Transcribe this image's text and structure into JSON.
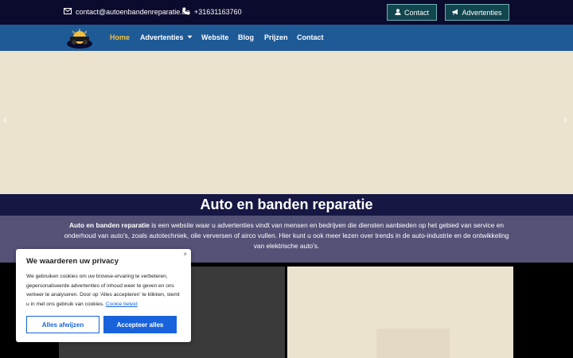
{
  "topbar": {
    "email": "contact@autoenbandenreparatie.be",
    "phone": "+31631163760",
    "contact_button": "Contact",
    "ads_button": "Advertenties"
  },
  "nav": {
    "items": [
      "Home",
      "Advertenties",
      "Website",
      "Blog",
      "Prijzen",
      "Contact"
    ],
    "active": "Home"
  },
  "hero": {
    "prev_arrow": "‹",
    "next_arrow": "›"
  },
  "page": {
    "title": "Auto en banden reparatie",
    "intro_bold": "Auto en banden reparatie",
    "intro_rest": " is een website waar u advertenties vindt van mensen en bedrijven die diensten aanbieden op het gebied van service en onderhoud van auto's, zoals autotechniek, olie verversen of airco vullen. Hier kunt u ook meer lezen over trends in de auto-industrie en de ontwikkeling van elektrische auto's."
  },
  "cookie": {
    "title": "We waarderen uw privacy",
    "text": "We gebruiken cookies om uw browse-ervaring te verbeteren, gepersonaliseerde advertenties of inhoud weer te geven en ons verkeer te analyseren. Door op 'Alles accepteren' te klikken, stemt u in met ons gebruik van cookies.",
    "policy_link": "Cookie beleid",
    "reject_button": "Alles afwijzen",
    "accept_button": "Accepteer alles",
    "close": "×"
  },
  "colors": {
    "topbar_bg": "#0b0b2e",
    "navbar_bg": "#1e5a96",
    "nav_active": "#f0c040",
    "button_bg": "#12464f",
    "accent_blue": "#1863dc"
  },
  "icons": [
    "envelope-icon",
    "phone-icon",
    "user-icon",
    "megaphone-icon",
    "chevron-down-icon",
    "logo-icon"
  ]
}
